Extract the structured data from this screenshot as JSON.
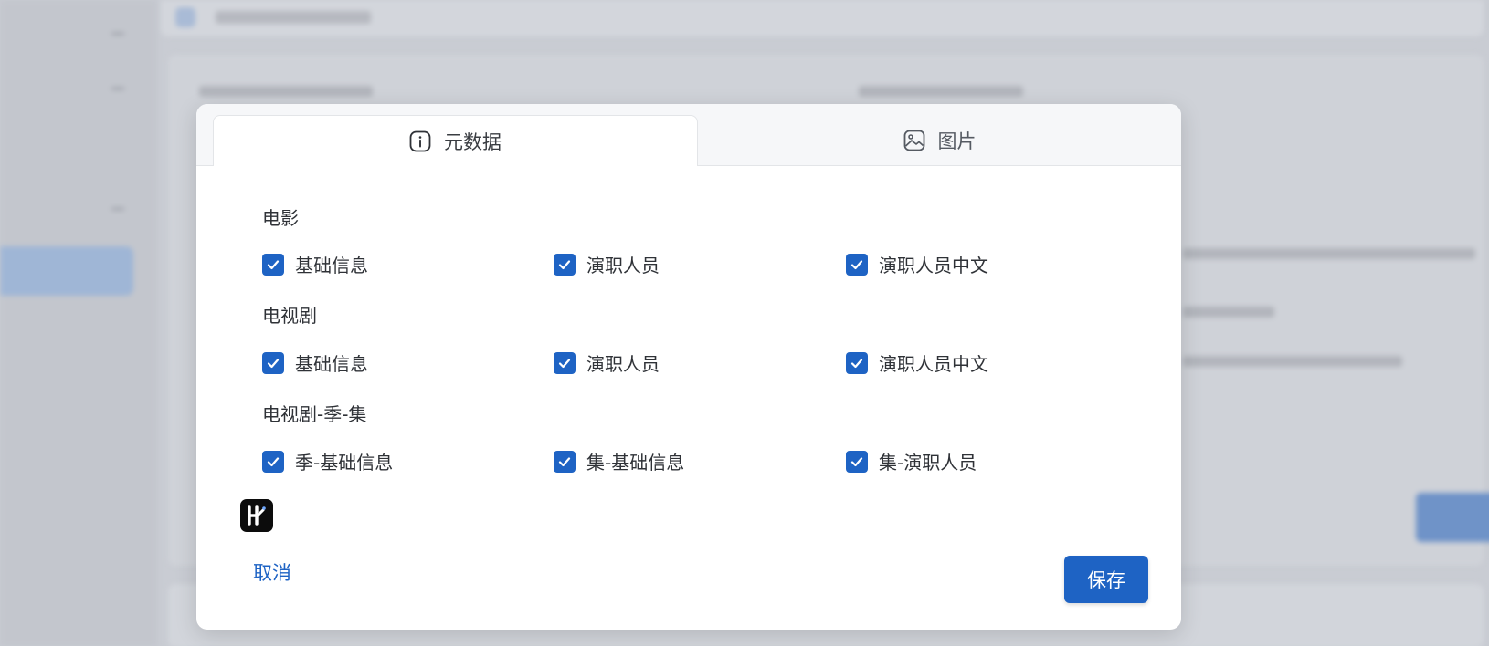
{
  "dialog": {
    "tabs": [
      {
        "label": "元数据",
        "icon": "info-icon",
        "active": true
      },
      {
        "label": "图片",
        "icon": "image-icon",
        "active": false
      }
    ],
    "sections": [
      {
        "title": "电影",
        "options": [
          {
            "label": "基础信息",
            "checked": true
          },
          {
            "label": "演职人员",
            "checked": true
          },
          {
            "label": "演职人员中文",
            "checked": true
          }
        ]
      },
      {
        "title": "电视剧",
        "options": [
          {
            "label": "基础信息",
            "checked": true
          },
          {
            "label": "演职人员",
            "checked": true
          },
          {
            "label": "演职人员中文",
            "checked": true
          }
        ]
      },
      {
        "title": "电视剧-季-集",
        "options": [
          {
            "label": "季-基础信息",
            "checked": true
          },
          {
            "label": "集-基础信息",
            "checked": true
          },
          {
            "label": "集-演职人员",
            "checked": true
          }
        ]
      }
    ],
    "cancel_label": "取消",
    "save_label": "保存"
  },
  "colors": {
    "accent": "#1e63c4",
    "overlay": "#c9ccd3"
  }
}
